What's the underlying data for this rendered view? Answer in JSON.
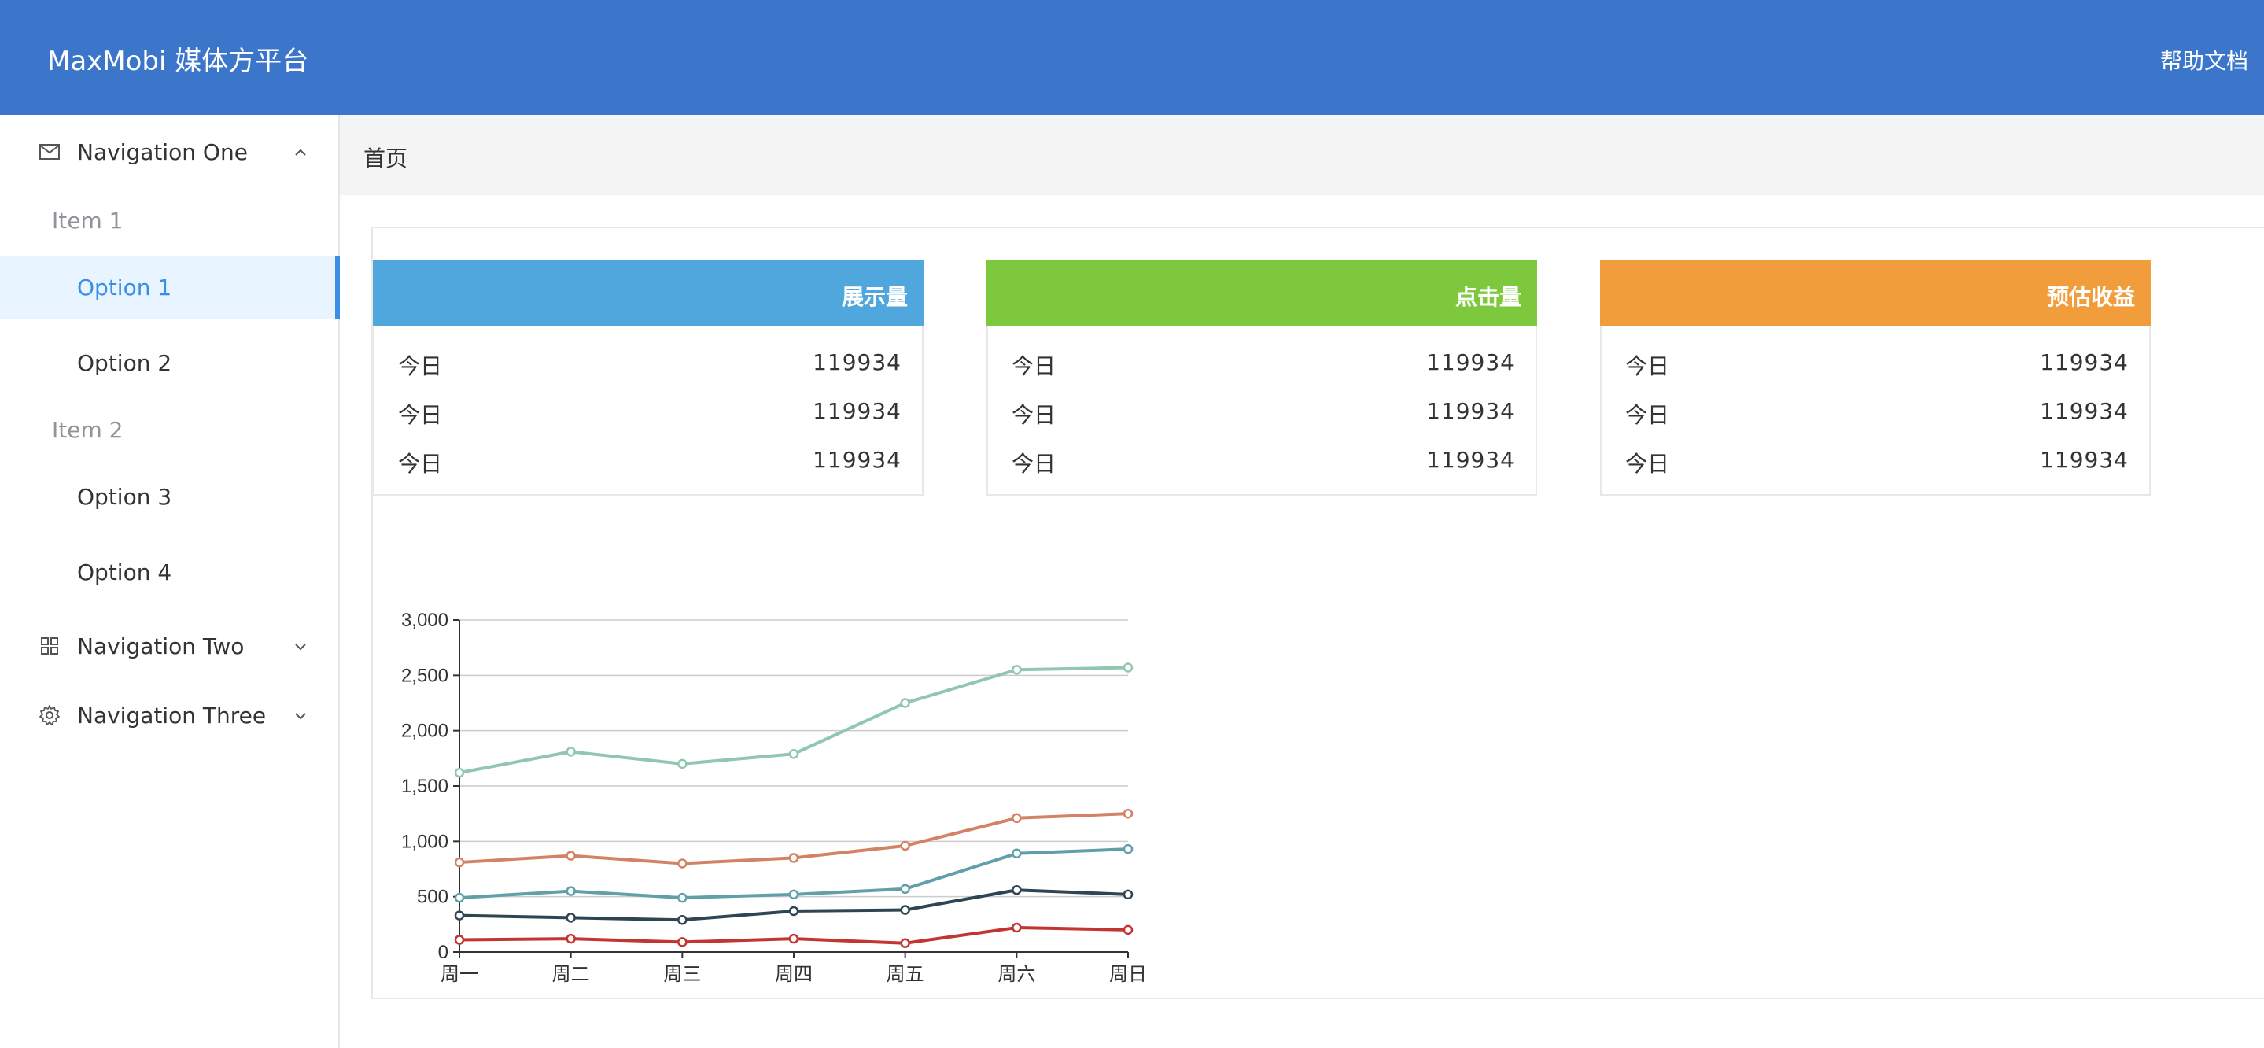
{
  "header": {
    "title": "MaxMobi 媒体方平台",
    "help_label": "帮助文档",
    "bg_color": "#3b76cb"
  },
  "sidebar": {
    "nav_one": {
      "label": "Navigation One",
      "icon": "mail-icon",
      "expanded": true
    },
    "groups": [
      {
        "label": "Item 1",
        "options": [
          {
            "label": "Option 1",
            "active": true
          },
          {
            "label": "Option 2",
            "active": false
          }
        ]
      },
      {
        "label": "Item 2",
        "options": [
          {
            "label": "Option 3",
            "active": false
          },
          {
            "label": "Option 4",
            "active": false
          }
        ]
      }
    ],
    "nav_two": {
      "label": "Navigation Two",
      "icon": "grid-icon",
      "expanded": false
    },
    "nav_three": {
      "label": "Navigation Three",
      "icon": "gear-icon",
      "expanded": false
    },
    "active_color": "#3a8ee6"
  },
  "breadcrumb": {
    "current": "首页"
  },
  "cards": [
    {
      "title": "展示量",
      "color": "#4fa7de",
      "rows": [
        {
          "label": "今日",
          "value": "119934"
        },
        {
          "label": "今日",
          "value": "119934"
        },
        {
          "label": "今日",
          "value": "119934"
        }
      ]
    },
    {
      "title": "点击量",
      "color": "#7ec83e",
      "rows": [
        {
          "label": "今日",
          "value": "119934"
        },
        {
          "label": "今日",
          "value": "119934"
        },
        {
          "label": "今日",
          "value": "119934"
        }
      ]
    },
    {
      "title": "预估收益",
      "color": "#f29d3b",
      "rows": [
        {
          "label": "今日",
          "value": "119934"
        },
        {
          "label": "今日",
          "value": "119934"
        },
        {
          "label": "今日",
          "value": "119934"
        }
      ]
    }
  ],
  "chart_data": {
    "type": "line",
    "title": "",
    "xlabel": "",
    "ylabel": "",
    "categories": [
      "周一",
      "周二",
      "周三",
      "周四",
      "周五",
      "周六",
      "周日"
    ],
    "ylim": [
      0,
      3000
    ],
    "yticks": [
      "0",
      "500",
      "1,000",
      "1,500",
      "2,000",
      "2,500",
      "3,000"
    ],
    "grid": true,
    "series": [
      {
        "color": "#91c7ae",
        "values": [
          1620,
          1810,
          1700,
          1790,
          2250,
          2550,
          2570
        ]
      },
      {
        "color": "#ca8622",
        "stroke": "#d48265",
        "values": [
          810,
          870,
          800,
          850,
          960,
          1210,
          1250
        ]
      },
      {
        "color": "#61a0a8",
        "values": [
          490,
          550,
          490,
          520,
          570,
          890,
          930
        ]
      },
      {
        "color": "#2f4554",
        "values": [
          330,
          310,
          290,
          370,
          380,
          560,
          520
        ]
      },
      {
        "color": "#c23531",
        "values": [
          110,
          120,
          90,
          120,
          80,
          220,
          200
        ]
      }
    ]
  }
}
